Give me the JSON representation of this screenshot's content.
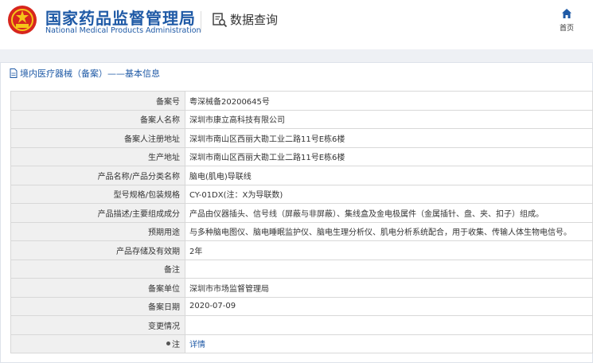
{
  "header": {
    "brand_cn": "国家药品监督管理局",
    "brand_en": "National Medical Products Administration",
    "query_label": "数据查询",
    "home_label": "首页",
    "brand_color": "#1f5aa6",
    "emblem_color": "#d7261e"
  },
  "breadcrumb": {
    "text": "境内医疗器械（备案）——基本信息"
  },
  "record": {
    "rows": [
      {
        "label": "备案号",
        "value": "粤深械备20200645号"
      },
      {
        "label": "备案人名称",
        "value": "深圳市康立高科技有限公司"
      },
      {
        "label": "备案人注册地址",
        "value": "深圳市南山区西丽大勘工业二路11号E栋6楼"
      },
      {
        "label": "生产地址",
        "value": "深圳市南山区西丽大勘工业二路11号E栋6楼"
      },
      {
        "label": "产品名称/产品分类名称",
        "value": "脑电(肌电)导联线"
      },
      {
        "label": "型号规格/包装规格",
        "value": "CY-01DX(注：X为导联数)"
      },
      {
        "label": "产品描述/主要组成成分",
        "value": "产品由仪器插头、信号线（屏蔽与非屏蔽）、集线盒及金电极属件（金属插针、盘、夹、扣子）组成。"
      },
      {
        "label": "预期用途",
        "value": "与多种脑电图仪、脑电睡眠监护仪、脑电生理分析仪、肌电分析系统配合，用于收集、传输人体生物电信号。"
      },
      {
        "label": "产品存储及有效期",
        "value": "2年"
      },
      {
        "label": "备注",
        "value": ""
      },
      {
        "label": "备案单位",
        "value": "深圳市市场监督管理局"
      },
      {
        "label": "备案日期",
        "value": "2020-07-09"
      },
      {
        "label": "变更情况",
        "value": ""
      },
      {
        "label": "注",
        "value": "详情"
      }
    ]
  }
}
